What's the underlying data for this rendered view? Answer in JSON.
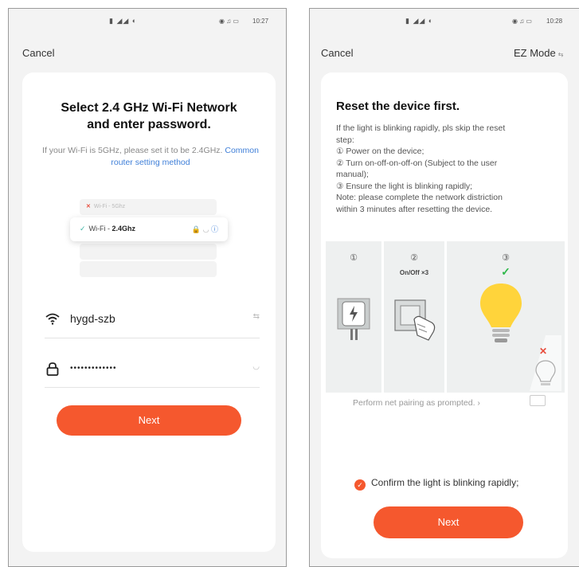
{
  "left_screen": {
    "status_time": "10:27",
    "status_indicators": "▮ ◢◢ ◐",
    "status_right_icons": "◉ ♫ ▭",
    "cancel_label": "Cancel",
    "title_line1": "Select 2.4 GHz Wi-Fi Network",
    "title_line2": "and enter password.",
    "hint_text": "If your Wi-Fi is 5GHz, please set it to be 2.4GHz. ",
    "hint_link": "Common router setting method",
    "illustration": {
      "bad_network": "Wi-Fi - 5Ghz",
      "good_network_prefix": "Wi-Fi - ",
      "good_network_band": "2.4Ghz"
    },
    "ssid_value": "hygd-szb",
    "password_value": "•••••••••••••",
    "next_label": "Next"
  },
  "right_screen": {
    "status_time": "10:28",
    "status_indicators": "▮ ◢◢ ◐",
    "status_right_icons": "◉ ♫ ▭",
    "cancel_label": "Cancel",
    "mode_label": "EZ Mode",
    "title": "Reset the device first.",
    "steps": [
      "If the light is blinking rapidly, pls skip the reset",
      "step:",
      "① Power on the device;",
      "② Turn on-off-on-off-on (Subject to the user",
      "manual);",
      "③ Ensure the light is blinking rapidly;",
      "Note: please complete the network distriction",
      "within 3 minutes after resetting the device."
    ],
    "step_numbers": [
      "①",
      "②",
      "③"
    ],
    "step2_label": "On/Off ×3",
    "pairing_text": "Perform net pairing as prompted.",
    "confirm_label": "Confirm the light is blinking rapidly;",
    "next_label": "Next"
  },
  "colors": {
    "accent": "#f5582e",
    "link": "#3f7fd8",
    "success": "#2fb84a",
    "error": "#e84d3d",
    "bulb": "#ffd43b"
  }
}
